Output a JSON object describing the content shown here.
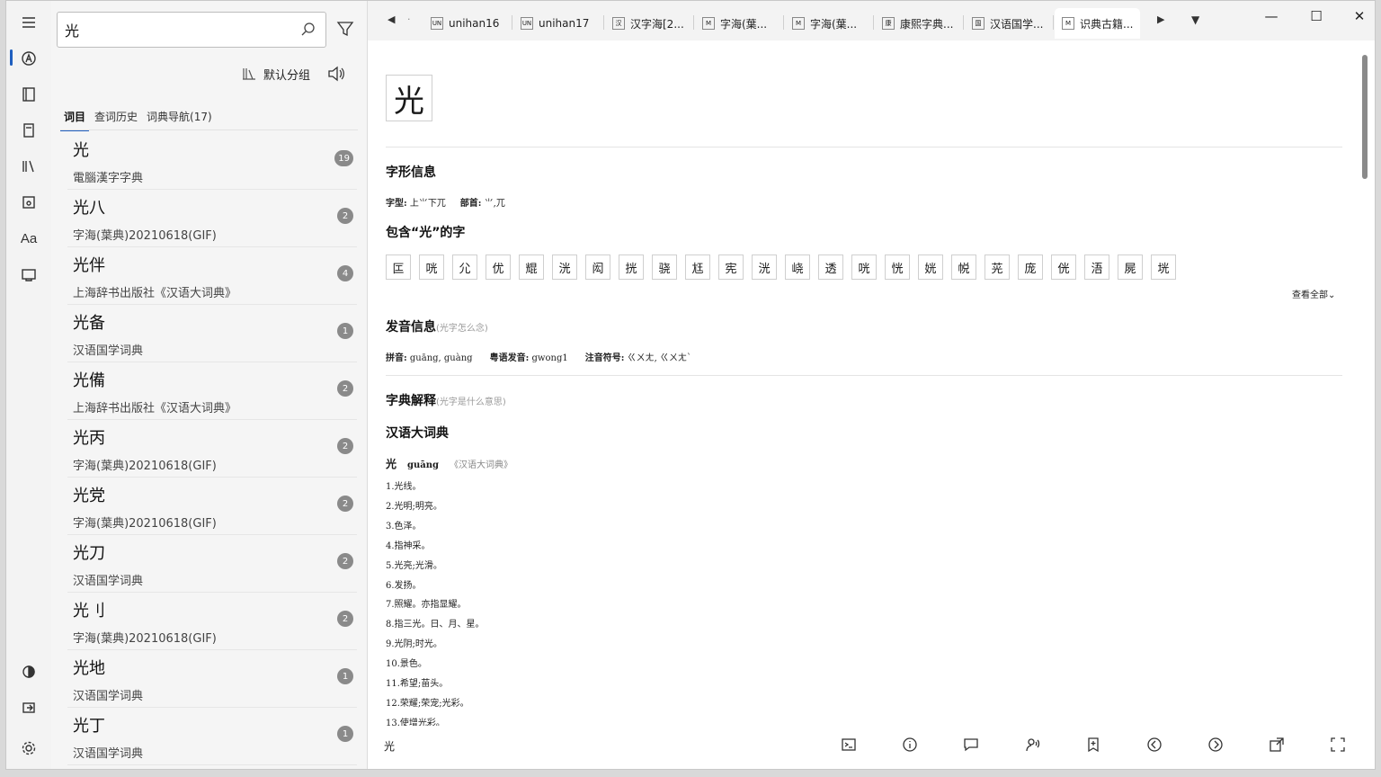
{
  "rail": {
    "menu_icon": "hamburger-icon"
  },
  "search": {
    "value": "光",
    "placeholder": ""
  },
  "group_label": "默认分组",
  "left_tabs": [
    "词目",
    "查词历史",
    "词典导航(17)"
  ],
  "results": [
    {
      "word": "光",
      "dict": "電腦漢字字典",
      "count": "19"
    },
    {
      "word": "光八",
      "dict": "字海(葉典)20210618(GIF)",
      "count": "2"
    },
    {
      "word": "光伴",
      "dict": "上海辞书出版社《汉语大词典》",
      "count": "4"
    },
    {
      "word": "光备",
      "dict": "汉语国学词典",
      "count": "1"
    },
    {
      "word": "光備",
      "dict": "上海辞书出版社《汉语大词典》",
      "count": "2"
    },
    {
      "word": "光丙",
      "dict": "字海(葉典)20210618(GIF)",
      "count": "2"
    },
    {
      "word": "光党",
      "dict": "字海(葉典)20210618(GIF)",
      "count": "2"
    },
    {
      "word": "光刀",
      "dict": "汉语国学词典",
      "count": "2"
    },
    {
      "word": "光刂",
      "dict": "字海(葉典)20210618(GIF)",
      "count": "2"
    },
    {
      "word": "光地",
      "dict": "汉语国学词典",
      "count": "1"
    },
    {
      "word": "光丁",
      "dict": "汉语国学词典",
      "count": "1"
    }
  ],
  "doc_tabs": [
    {
      "label": "unihan16",
      "icon": "UN"
    },
    {
      "label": "unihan17",
      "icon": "UN"
    },
    {
      "label": "汉字海[2...",
      "icon": "汉"
    },
    {
      "label": "字海(葉...",
      "icon": "M"
    },
    {
      "label": "字海(葉...",
      "icon": "M"
    },
    {
      "label": "康熙字典...",
      "icon": "康"
    },
    {
      "label": "汉语国学...",
      "icon": "国"
    },
    {
      "label": "识典古籍...",
      "icon": "M"
    }
  ],
  "entry": {
    "char": "光",
    "glyph_title": "字形信息",
    "glyph_meta_label1": "字型:",
    "glyph_meta_val1": "上⺌下兀",
    "glyph_meta_label2": "部首:",
    "glyph_meta_val2": "⺌,兀",
    "contains_title": "包含“光”的字",
    "contains": [
      "匞",
      "咣",
      "尣",
      "优",
      "尡",
      "洸",
      "闳",
      "挄",
      "骁",
      "尪",
      "宪",
      "洸",
      "峣",
      "透",
      "咣",
      "恍",
      "姯",
      "帨",
      "茪",
      "庞",
      "侊",
      "浯",
      "屍",
      "垙"
    ],
    "more": "查看全部⌄",
    "pron_title": "发音信息",
    "pron_sub": "(光字怎么念)",
    "pron_label1": "拼音:",
    "pron_val1": "guāng, guàng",
    "pron_label2": "粤语发音:",
    "pron_val2": "gwong1",
    "pron_label3": "注音符号:",
    "pron_val3": "ㄍㄨㄤ, ㄍㄨㄤˋ",
    "def_title": "字典解释",
    "def_sub": "(光字是什么意思)",
    "dict_title": "汉语大词典",
    "head_word": "光",
    "head_pinyin": "guāng",
    "head_src": "《汉语大词典》",
    "defs": [
      "1.光线。",
      "2.光明;明亮。",
      "3.色泽。",
      "4.指神采。",
      "5.光亮;光滑。",
      "6.发扬。",
      "7.照耀。亦指显耀。",
      "8.指三光。日、月、星。",
      "9.光阴;时光。",
      "10.景色。",
      "11.希望;苗头。",
      "12.荣耀;荣宠;光彩。",
      "13.使增光彩。"
    ]
  },
  "bottom_word": "光"
}
